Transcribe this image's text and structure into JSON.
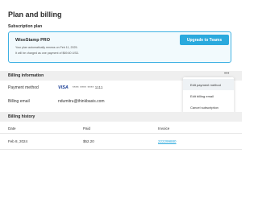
{
  "page": {
    "title": "Plan and billing"
  },
  "subscription": {
    "section_label": "Subscription plan",
    "plan_name": "WiseStamp PRO",
    "renew_note": "Your plan automatically renews on Feb 11, 2025.",
    "charge_note": "It will be charged as one payment of $69.60 USD.",
    "upgrade_label": "Upgrade to Teams"
  },
  "billing_info": {
    "title": "Billing information",
    "payment_label": "Payment method",
    "card_brand": "VISA",
    "card_number": "**** **** **** 1111",
    "email_label": "Billing email",
    "email_value": "ndumitru@thinkbasis.com",
    "more_icon": "more-dots-icon"
  },
  "menu": {
    "items": [
      "Edit payment method",
      "Edit billing email",
      "Cancel subscription"
    ]
  },
  "billing_history": {
    "title": "Billing history",
    "columns": [
      "Date",
      "Paid",
      "Invoice"
    ],
    "rows": [
      {
        "date": "Feb 8, 2024",
        "paid": "$52.20",
        "invoice": "222299880"
      }
    ]
  },
  "colors": {
    "accent": "#2aa9dd",
    "card_border": "#3fb1e3",
    "card_bg": "#f2fafd",
    "section_bar": "#efefef"
  }
}
